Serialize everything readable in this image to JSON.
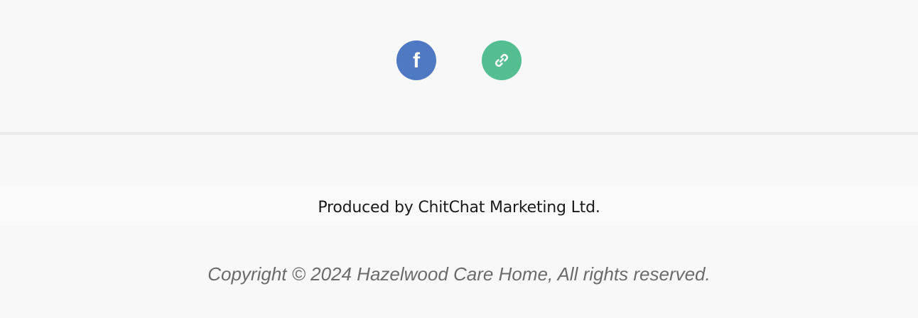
{
  "social": {
    "facebook": {
      "icon": "facebook-icon",
      "color": "#5079c4",
      "label": "f"
    },
    "link": {
      "icon": "link-icon",
      "color": "#54bd91"
    }
  },
  "footer": {
    "produced_by": "Produced by ChitChat Marketing Ltd.",
    "copyright": "Copyright © 2024 Hazelwood Care Home, All rights reserved."
  },
  "colors": {
    "background": "#f8f8f8",
    "divider": "#e9e9e9",
    "copyright_text": "#6b6b6b"
  }
}
